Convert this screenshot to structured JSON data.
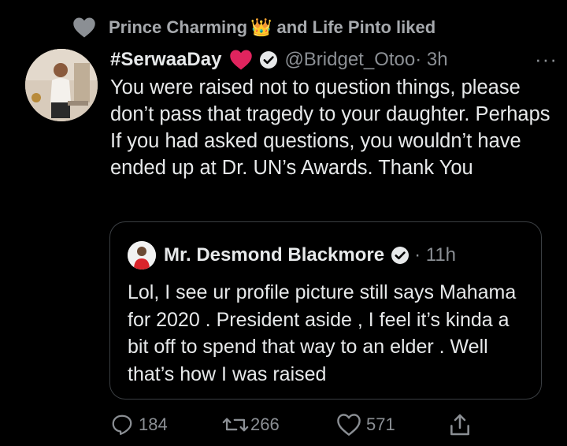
{
  "social_context": {
    "text_before": "Prince Charming",
    "crown_emoji": "👑",
    "text_after": "and Life Pinto liked"
  },
  "tweet": {
    "name": "#SerwaaDay",
    "handle": "@Bridget_Otoo",
    "time": "· 3h",
    "more_label": "···",
    "text": "You were raised not to question things, please don’t pass that tragedy to your daughter. Perhaps If you had asked questions, you wouldn’t have ended up at Dr. UN’s Awards. Thank You"
  },
  "quote": {
    "name": "Mr. Desmond Blackmore",
    "time": "· 11h",
    "text": "Lol, I see ur profile picture still says Mahama for 2020 . President aside , I feel it’s kinda a bit off to spend that way to an elder . Well that’s how I was raised"
  },
  "actions": {
    "replies": "184",
    "retweets": "266",
    "likes": "571"
  },
  "colors": {
    "background": "#000000",
    "text": "#e7e9ea",
    "muted": "#8b8f94",
    "heart": "#e0245e",
    "border": "#3b3f43"
  },
  "icons": {
    "social": "heart-icon",
    "verified": "verified-badge-icon",
    "reply": "reply-icon",
    "retweet": "retweet-icon",
    "like": "like-icon",
    "share": "share-icon"
  }
}
